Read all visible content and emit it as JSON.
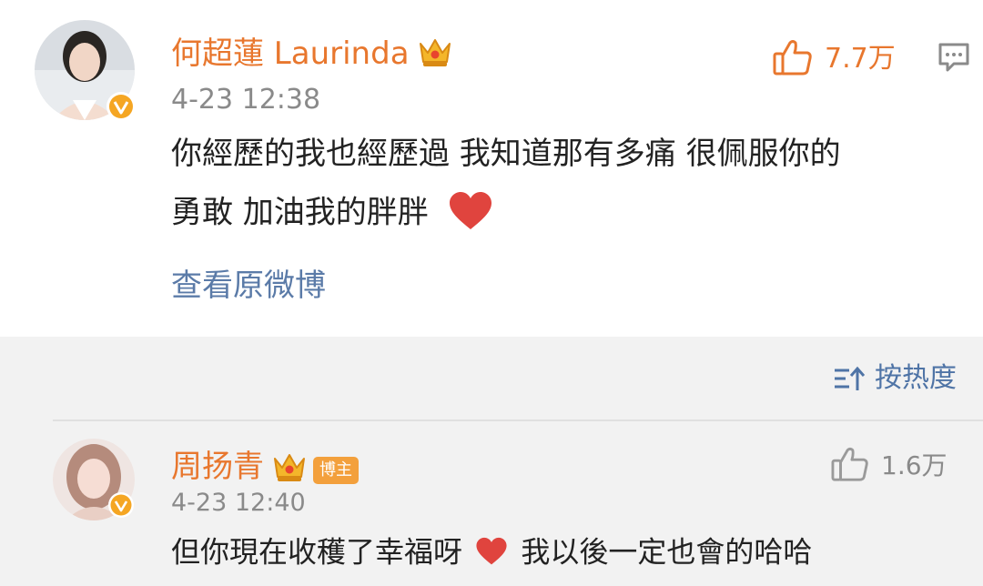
{
  "comment_main": {
    "username": "何超蓮 Laurinda",
    "time": "4-23 12:38",
    "content_line1": "你經歷的我也經歷過 我知道那有多痛 很佩服你的",
    "content_line2": "勇敢 加油我的胖胖",
    "like_count": "7.7万",
    "view_original_label": "查看原微博"
  },
  "sort": {
    "label": "按热度"
  },
  "reply": {
    "username": "周扬青",
    "badge": "博主",
    "time": "4-23 12:40",
    "content_before_heart": "但你現在收穫了幸福呀",
    "content_after_heart": "我以後一定也會的哈哈",
    "like_count": "1.6万"
  },
  "colors": {
    "username": "#e8772e",
    "link": "#5b7ba8",
    "sort": "#4f74a6",
    "heart": "#e0443e",
    "like_active": "#e8772e",
    "like_inactive": "#9a9a9a",
    "host_badge": "#f3a03c",
    "verified": "#f5a623"
  },
  "icons": [
    "thumbs-up-icon",
    "comment-icon",
    "crown-icon",
    "verified-v-icon",
    "heart-icon",
    "sort-icon"
  ]
}
